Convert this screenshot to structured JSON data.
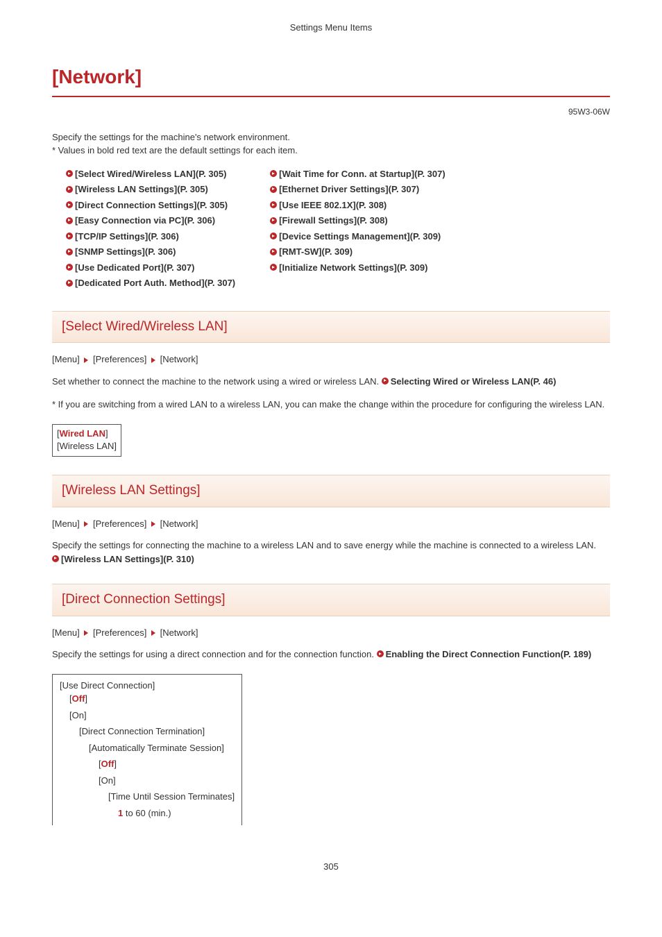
{
  "running_header": "Settings Menu Items",
  "doc_id": "95W3-06W",
  "title": "[Network]",
  "intro_line1": "Specify the settings for the machine's network environment.",
  "intro_line2": "* Values in bold red text are the default settings for each item.",
  "links_col1": [
    "[Select Wired/Wireless LAN](P. 305)",
    "[Wireless LAN Settings](P. 305)",
    "[Direct Connection Settings](P. 305)",
    "[Easy Connection via PC](P. 306)",
    "[TCP/IP Settings](P. 306)",
    "[SNMP Settings](P. 306)",
    "[Use Dedicated Port](P. 307)",
    "[Dedicated Port Auth. Method](P. 307)"
  ],
  "links_col2": [
    "[Wait Time for Conn. at Startup](P. 307)",
    "[Ethernet Driver Settings](P. 307)",
    "[Use IEEE 802.1X](P. 308)",
    "[Firewall Settings](P. 308)",
    "[Device Settings Management](P. 309)",
    "[RMT-SW](P. 309)",
    "[Initialize Network Settings](P. 309)"
  ],
  "breadcrumb": {
    "a": "[Menu]",
    "b": "[Preferences]",
    "c": "[Network]"
  },
  "section1": {
    "title": "[Select Wired/Wireless LAN]",
    "body_plain": "Set whether to connect the machine to the network using a wired or wireless LAN. ",
    "body_link": "Selecting Wired or Wireless LAN(P. 46)",
    "note": "* If you are switching from a wired LAN to a wireless LAN, you can make the change within the procedure for configuring the wireless LAN.",
    "opt_default": "Wired LAN",
    "opt_other": "[Wireless LAN]"
  },
  "section2": {
    "title": "[Wireless LAN Settings]",
    "body": "Specify the settings for connecting the machine to a wireless LAN and to save energy while the machine is connected to a wireless LAN.",
    "link": "[Wireless LAN Settings](P. 310)"
  },
  "section3": {
    "title": "[Direct Connection Settings]",
    "body_plain": "Specify the settings for using a direct connection and for the connection function. ",
    "body_link": "Enabling the Direct Connection Function(P. 189)",
    "tree": {
      "l0": "[Use Direct Connection]",
      "l1_off": "Off",
      "l1_on": "[On]",
      "l2": "[Direct Connection Termination]",
      "l3": "[Automatically Terminate Session]",
      "l4_off": "Off",
      "l4_on": "[On]",
      "l5": "[Time Until Session Terminates]",
      "l6_default": "1",
      "l6_rest": " to 60 (min.)"
    }
  },
  "page_number": "305"
}
